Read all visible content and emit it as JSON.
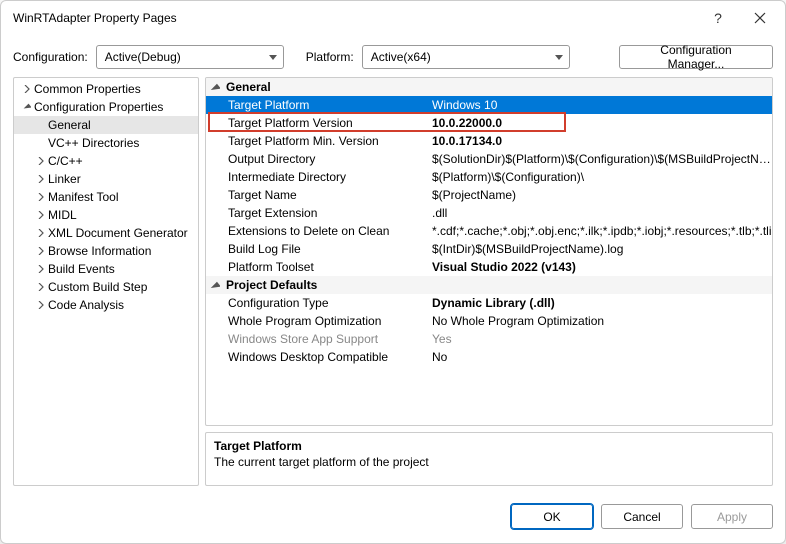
{
  "title": "WinRTAdapter Property Pages",
  "header": {
    "config_label": "Configuration:",
    "config_value": "Active(Debug)",
    "platform_label": "Platform:",
    "platform_value": "Active(x64)",
    "config_mgr": "Configuration Manager..."
  },
  "tree": {
    "items": [
      {
        "label": "Common Properties",
        "level": 0,
        "expanded": false,
        "hasArrow": true
      },
      {
        "label": "Configuration Properties",
        "level": 0,
        "expanded": true,
        "hasArrow": true
      },
      {
        "label": "General",
        "level": 1,
        "selected": true
      },
      {
        "label": "VC++ Directories",
        "level": 1
      },
      {
        "label": "C/C++",
        "level": 1,
        "hasArrow": true,
        "expanded": false
      },
      {
        "label": "Linker",
        "level": 1,
        "hasArrow": true,
        "expanded": false
      },
      {
        "label": "Manifest Tool",
        "level": 1,
        "hasArrow": true,
        "expanded": false
      },
      {
        "label": "MIDL",
        "level": 1,
        "hasArrow": true,
        "expanded": false
      },
      {
        "label": "XML Document Generator",
        "level": 1,
        "hasArrow": true,
        "expanded": false
      },
      {
        "label": "Browse Information",
        "level": 1,
        "hasArrow": true,
        "expanded": false
      },
      {
        "label": "Build Events",
        "level": 1,
        "hasArrow": true,
        "expanded": false
      },
      {
        "label": "Custom Build Step",
        "level": 1,
        "hasArrow": true,
        "expanded": false
      },
      {
        "label": "Code Analysis",
        "level": 1,
        "hasArrow": true,
        "expanded": false
      }
    ]
  },
  "grid": {
    "cats": [
      {
        "name": "General",
        "rows": [
          {
            "k": "Target Platform",
            "v": "Windows 10",
            "selected": true
          },
          {
            "k": "Target Platform Version",
            "v": "10.0.22000.0",
            "boldv": true,
            "highlight": true
          },
          {
            "k": "Target Platform Min. Version",
            "v": "10.0.17134.0",
            "boldv": true
          },
          {
            "k": "Output Directory",
            "v": "$(SolutionDir)$(Platform)\\$(Configuration)\\$(MSBuildProjectName)\\"
          },
          {
            "k": "Intermediate Directory",
            "v": "$(Platform)\\$(Configuration)\\"
          },
          {
            "k": "Target Name",
            "v": "$(ProjectName)"
          },
          {
            "k": "Target Extension",
            "v": ".dll"
          },
          {
            "k": "Extensions to Delete on Clean",
            "v": "*.cdf;*.cache;*.obj;*.obj.enc;*.ilk;*.ipdb;*.iobj;*.resources;*.tlb;*.tli"
          },
          {
            "k": "Build Log File",
            "v": "$(IntDir)$(MSBuildProjectName).log"
          },
          {
            "k": "Platform Toolset",
            "v": "Visual Studio 2022 (v143)",
            "boldv": true
          }
        ]
      },
      {
        "name": "Project Defaults",
        "rows": [
          {
            "k": "Configuration Type",
            "v": "Dynamic Library (.dll)",
            "boldv": true
          },
          {
            "k": "Whole Program Optimization",
            "v": "No Whole Program Optimization"
          },
          {
            "k": "Windows Store App Support",
            "v": "Yes",
            "dim": true
          },
          {
            "k": "Windows Desktop Compatible",
            "v": "No"
          }
        ]
      }
    ]
  },
  "desc": {
    "title": "Target Platform",
    "text": "The current target platform of the project"
  },
  "footer": {
    "ok": "OK",
    "cancel": "Cancel",
    "apply": "Apply"
  }
}
